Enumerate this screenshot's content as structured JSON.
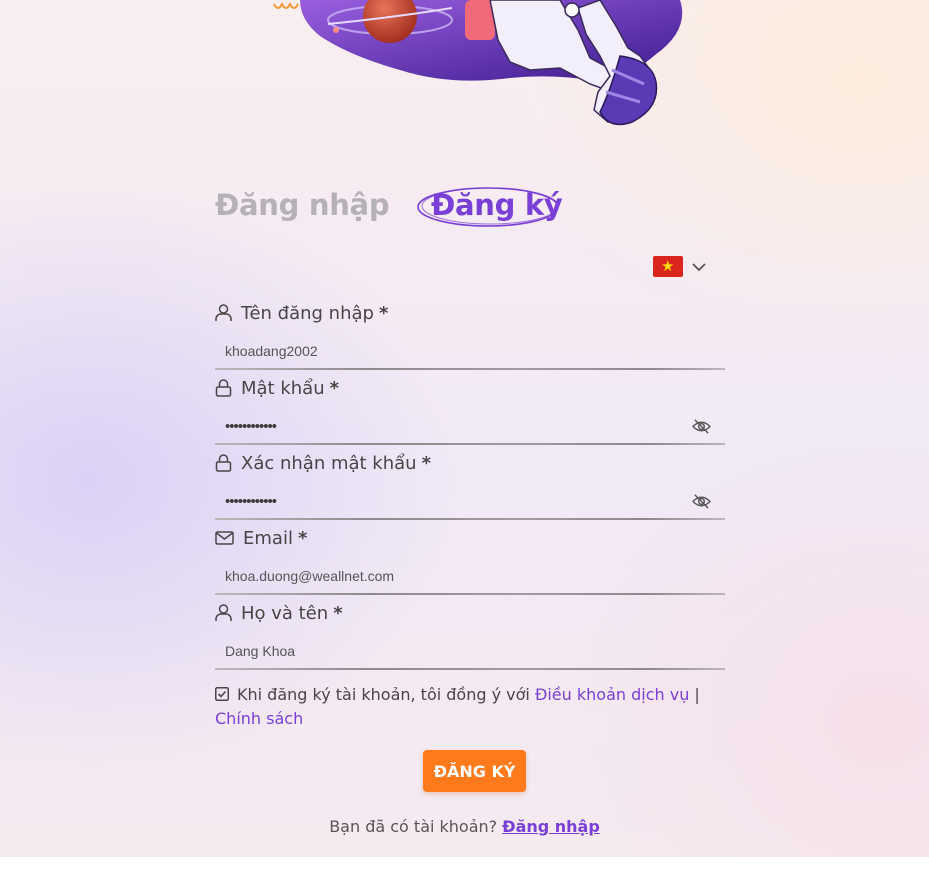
{
  "tabs": {
    "login": "Đăng nhập",
    "register": "Đăng ký"
  },
  "language": {
    "flag_icon": "vietnam-flag-icon",
    "chevron_icon": "chevron-down-icon"
  },
  "fields": {
    "username": {
      "label": "Tên đăng nhập",
      "required": "*",
      "value": "khoadang2002",
      "icon": "user-icon"
    },
    "password": {
      "label": "Mật khẩu",
      "required": "*",
      "value": "••••••••••••",
      "icon": "lock-icon",
      "toggle_icon": "eye-off-icon"
    },
    "confirm_password": {
      "label": "Xác nhận mật khẩu",
      "required": "*",
      "value": "••••••••••••",
      "icon": "lock-icon",
      "toggle_icon": "eye-off-icon"
    },
    "email": {
      "label": "Email",
      "required": "*",
      "value": "khoa.duong@weallnet.com",
      "icon": "mail-icon"
    },
    "fullname": {
      "label": "Họ và tên",
      "required": "*",
      "value": "Dang Khoa",
      "icon": "user-icon"
    }
  },
  "terms": {
    "checked": true,
    "text": "Khi đăng ký tài khoản, tôi đồng ý với",
    "terms_link": "Điều khoản dịch vụ",
    "separator": "|",
    "policy_link": "Chính sách"
  },
  "submit_label": "ĐĂNG KÝ",
  "footer": {
    "text": "Bạn đã có tài khoản?",
    "login_link": "Đăng nhập"
  },
  "colors": {
    "accent": "#7a3fd6",
    "button": "#ff7a1a",
    "flag_red": "#da251d",
    "flag_star": "#ffde00"
  }
}
